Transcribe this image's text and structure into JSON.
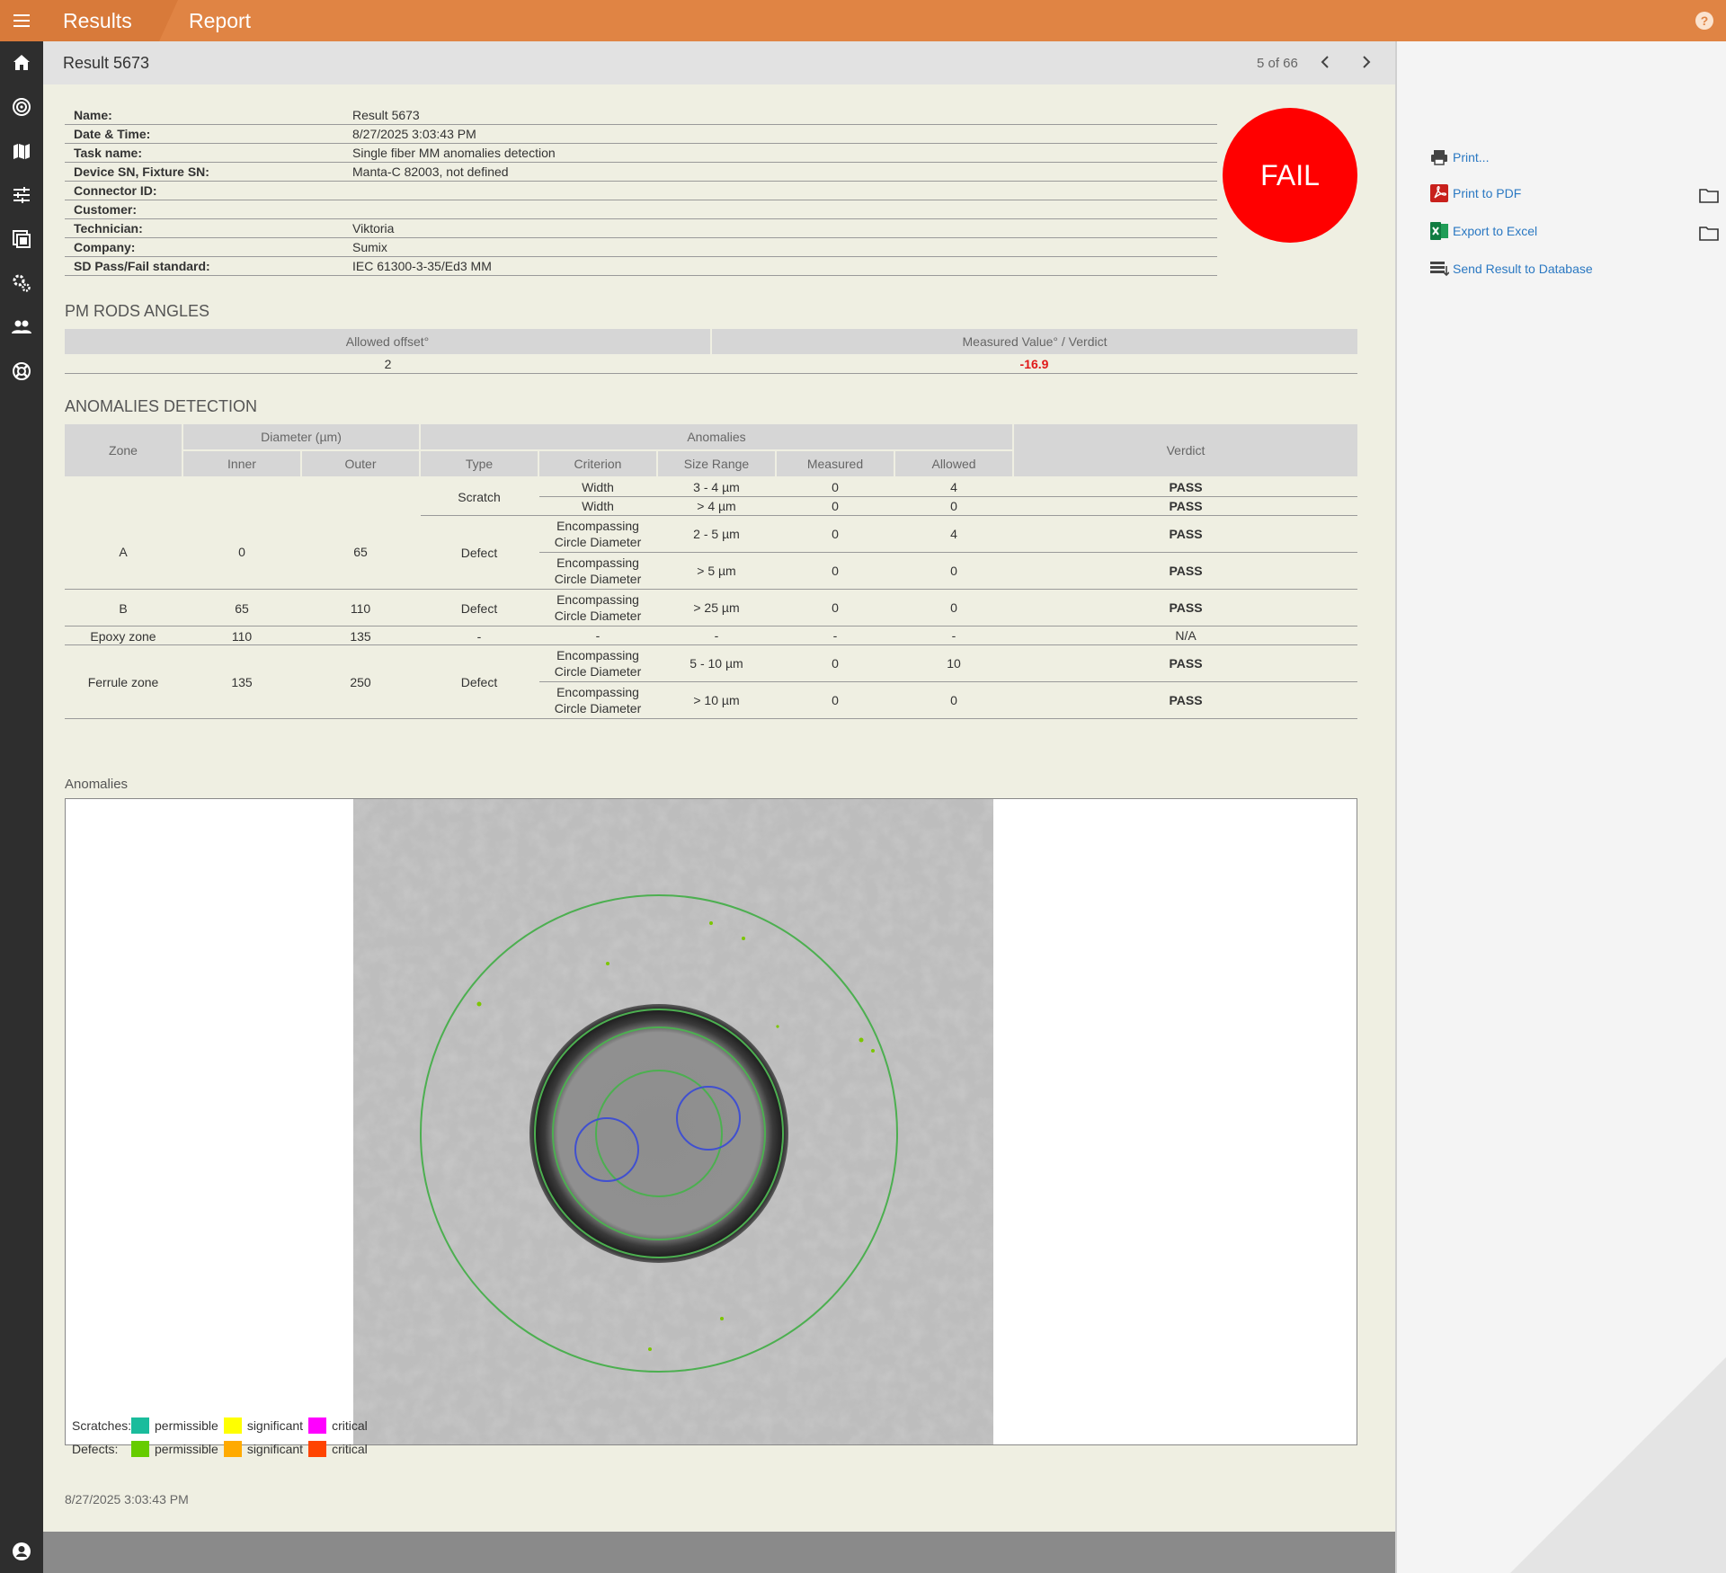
{
  "header": {
    "crumb_results": "Results",
    "crumb_report": "Report",
    "help": "?"
  },
  "nav_icons": [
    "menu-icon",
    "home-icon",
    "target-icon",
    "map-icon",
    "sliders-icon",
    "gallery-icon",
    "settings-icon",
    "users-icon",
    "support-icon",
    "user-icon"
  ],
  "result": {
    "title": "Result 5673",
    "pager": "5 of 66",
    "verdict": "FAIL"
  },
  "info": [
    {
      "k": "Name:",
      "v": "Result 5673"
    },
    {
      "k": "Date & Time:",
      "v": "8/27/2025 3:03:43 PM"
    },
    {
      "k": "Task name:",
      "v": "Single fiber MM anomalies detection"
    },
    {
      "k": "Device SN, Fixture SN:",
      "v": "Manta-C 82003, not defined"
    },
    {
      "k": "Connector ID:",
      "v": ""
    },
    {
      "k": "Customer:",
      "v": ""
    },
    {
      "k": "Technician:",
      "v": "Viktoria"
    },
    {
      "k": "Company:",
      "v": "Sumix"
    },
    {
      "k": "SD Pass/Fail standard:",
      "v": "IEC 61300-3-35/Ed3 MM"
    }
  ],
  "pm_rods": {
    "title": "PM RODS ANGLES",
    "headers": [
      "Allowed offset°",
      "Measured Value° / Verdict"
    ],
    "allowed": "2",
    "measured": "-16.9"
  },
  "anomalies": {
    "title": "ANOMALIES DETECTION",
    "headers": {
      "zone": "Zone",
      "diameter": "Diameter (µm)",
      "inner": "Inner",
      "outer": "Outer",
      "anomalies": "Anomalies",
      "type": "Type",
      "criterion": "Criterion",
      "size_range": "Size Range",
      "measured": "Measured",
      "allowed": "Allowed",
      "verdict": "Verdict"
    },
    "zones": [
      {
        "zone": "A",
        "inner": "0",
        "outer": "65"
      },
      {
        "zone": "B",
        "inner": "65",
        "outer": "110"
      },
      {
        "zone": "Epoxy zone",
        "inner": "110",
        "outer": "135"
      },
      {
        "zone": "Ferrule zone",
        "inner": "135",
        "outer": "250"
      }
    ],
    "types": [
      "Scratch",
      "Defect",
      "Defect",
      "-",
      "Defect"
    ],
    "rows": [
      {
        "criterion": "Width",
        "size": "3 - 4 µm",
        "measured": "0",
        "allowed": "4",
        "verdict": "PASS"
      },
      {
        "criterion": "Width",
        "size": "> 4 µm",
        "measured": "0",
        "allowed": "0",
        "verdict": "PASS"
      },
      {
        "criterion": "Encompassing Circle Diameter",
        "size": "2 - 5 µm",
        "measured": "0",
        "allowed": "4",
        "verdict": "PASS"
      },
      {
        "criterion": "Encompassing Circle Diameter",
        "size": "> 5 µm",
        "measured": "0",
        "allowed": "0",
        "verdict": "PASS"
      },
      {
        "criterion": "Encompassing Circle Diameter",
        "size": "> 25 µm",
        "measured": "0",
        "allowed": "0",
        "verdict": "PASS"
      },
      {
        "criterion": "-",
        "size": "-",
        "measured": "-",
        "allowed": "-",
        "verdict": "N/A"
      },
      {
        "criterion": "Encompassing Circle Diameter",
        "size": "5 - 10 µm",
        "measured": "0",
        "allowed": "10",
        "verdict": "PASS"
      },
      {
        "criterion": "Encompassing Circle Diameter",
        "size": "> 10 µm",
        "measured": "0",
        "allowed": "0",
        "verdict": "PASS"
      }
    ]
  },
  "image_section": {
    "label": "Anomalies"
  },
  "legend": {
    "scratches_label": "Scratches:",
    "defects_label": "Defects:",
    "scratches": [
      {
        "name": "permissible",
        "color": "#1abc9c"
      },
      {
        "name": "significant",
        "color": "#ffff00"
      },
      {
        "name": "critical",
        "color": "#ff00ff"
      }
    ],
    "defects": [
      {
        "name": "permissible",
        "color": "#66cc00"
      },
      {
        "name": "significant",
        "color": "#ffaa00"
      },
      {
        "name": "critical",
        "color": "#ff4400"
      }
    ]
  },
  "timestamp": "8/27/2025 3:03:43 PM",
  "actions": {
    "print": "Print...",
    "pdf": "Print to PDF",
    "excel": "Export to Excel",
    "database": "Send Result to Database"
  }
}
